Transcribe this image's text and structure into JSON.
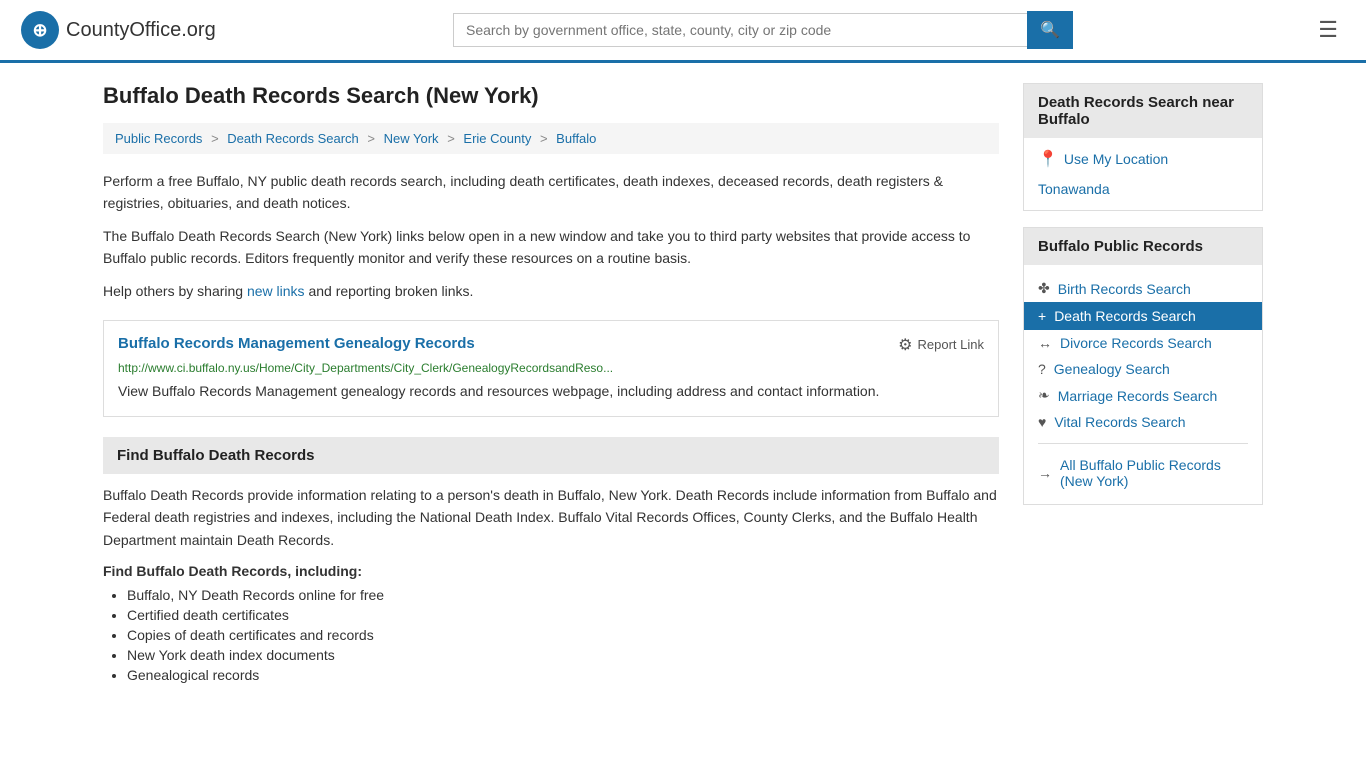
{
  "header": {
    "logo_text": "CountyOffice",
    "logo_suffix": ".org",
    "search_placeholder": "Search by government office, state, county, city or zip code",
    "search_value": ""
  },
  "page": {
    "title": "Buffalo Death Records Search (New York)"
  },
  "breadcrumb": {
    "items": [
      {
        "label": "Public Records",
        "href": "#"
      },
      {
        "label": "Death Records Search",
        "href": "#"
      },
      {
        "label": "New York",
        "href": "#"
      },
      {
        "label": "Erie County",
        "href": "#"
      },
      {
        "label": "Buffalo",
        "href": "#"
      }
    ]
  },
  "intro": {
    "paragraph1": "Perform a free Buffalo, NY public death records search, including death certificates, death indexes, deceased records, death registers & registries, obituaries, and death notices.",
    "paragraph2": "The Buffalo Death Records Search (New York) links below open in a new window and take you to third party websites that provide access to Buffalo public records. Editors frequently monitor and verify these resources on a routine basis.",
    "paragraph3_before": "Help others by sharing ",
    "paragraph3_link": "new links",
    "paragraph3_after": " and reporting broken links."
  },
  "record": {
    "title": "Buffalo Records Management Genealogy Records",
    "title_href": "#",
    "report_label": "Report Link",
    "url": "http://www.ci.buffalo.ny.us/Home/City_Departments/City_Clerk/GenealogyRecordsandReso...",
    "description": "View Buffalo Records Management genealogy records and resources webpage, including address and contact information."
  },
  "find_section": {
    "header": "Find Buffalo Death Records",
    "paragraph": "Buffalo Death Records provide information relating to a person's death in Buffalo, New York. Death Records include information from Buffalo and Federal death registries and indexes, including the National Death Index. Buffalo Vital Records Offices, County Clerks, and the Buffalo Health Department maintain Death Records.",
    "list_header": "Find Buffalo Death Records, including:",
    "items": [
      "Buffalo, NY Death Records online for free",
      "Certified death certificates",
      "Copies of death certificates and records",
      "New York death index documents",
      "Genealogical records"
    ]
  },
  "sidebar": {
    "death_nearby": {
      "header": "Death Records Search near Buffalo",
      "use_location_label": "Use My Location",
      "nearby_links": [
        {
          "label": "Tonawanda"
        }
      ]
    },
    "public_records": {
      "header": "Buffalo Public Records",
      "links": [
        {
          "label": "Birth Records Search",
          "icon": "✤",
          "active": false
        },
        {
          "label": "Death Records Search",
          "icon": "+",
          "active": true
        },
        {
          "label": "Divorce Records Search",
          "icon": "↔",
          "active": false
        },
        {
          "label": "Genealogy Search",
          "icon": "?",
          "active": false
        },
        {
          "label": "Marriage Records Search",
          "icon": "❧",
          "active": false
        },
        {
          "label": "Vital Records Search",
          "icon": "♥",
          "active": false
        },
        {
          "label": "All Buffalo Public Records (New York)",
          "icon": "→",
          "active": false
        }
      ]
    }
  }
}
